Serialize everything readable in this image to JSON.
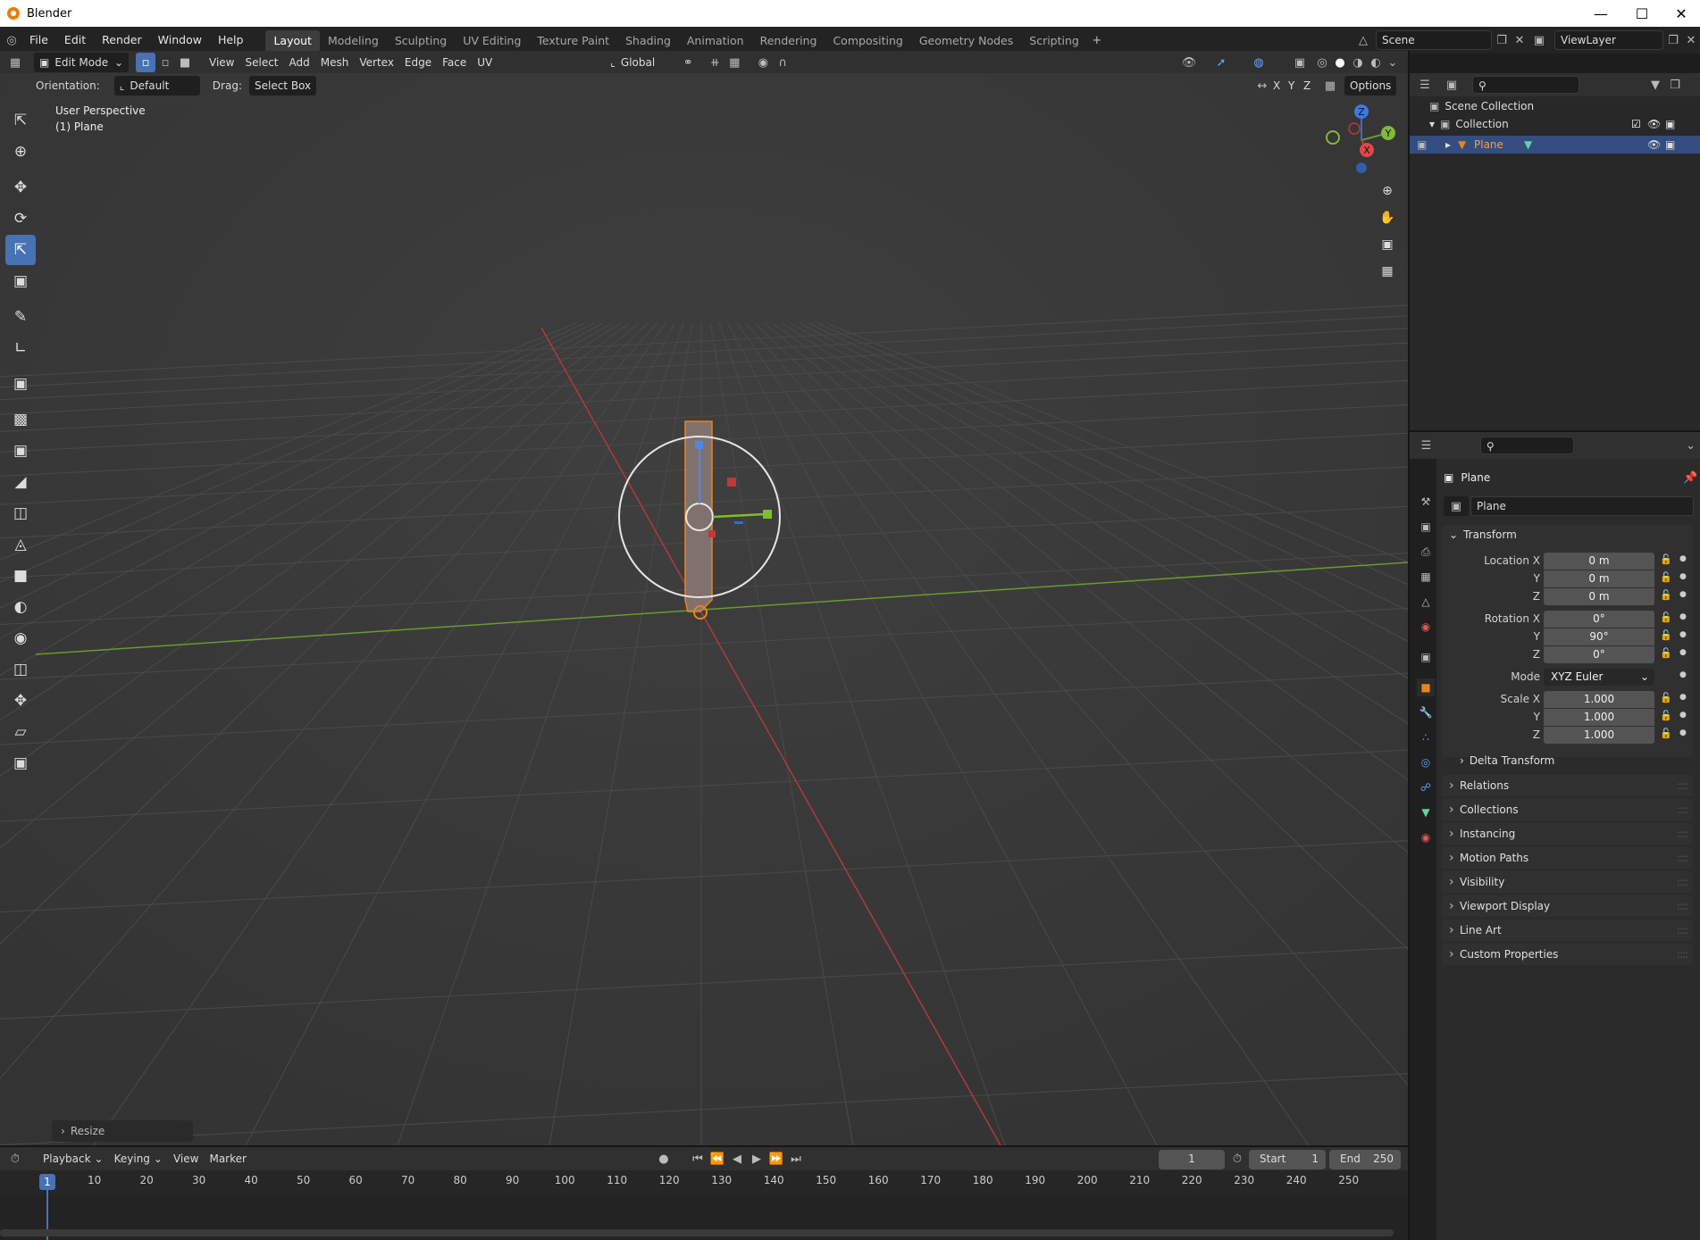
{
  "app": {
    "title": "Blender"
  },
  "menus": [
    "File",
    "Edit",
    "Render",
    "Window",
    "Help"
  ],
  "workspaces": [
    "Layout",
    "Modeling",
    "Sculpting",
    "UV Editing",
    "Texture Paint",
    "Shading",
    "Animation",
    "Rendering",
    "Compositing",
    "Geometry Nodes",
    "Scripting"
  ],
  "scene": {
    "name": "Scene",
    "view_layer": "ViewLayer"
  },
  "viewport_header": {
    "mode": "Edit Mode",
    "menus": [
      "View",
      "Select",
      "Add",
      "Mesh",
      "Vertex",
      "Edge",
      "Face",
      "UV"
    ],
    "transform_orientation": "Global",
    "orientation_label": "Orientation:",
    "orientation_value": "Default",
    "drag_label": "Drag:",
    "drag_value": "Select Box",
    "axes": [
      "X",
      "Y",
      "Z"
    ],
    "options": "Options"
  },
  "viewport": {
    "perspective": "User Perspective",
    "object": "(1) Plane",
    "last_operator": "Resize",
    "gizmo_axes": {
      "z": "Z",
      "y": "Y",
      "x": "X"
    }
  },
  "outliner": {
    "search_placeholder": "",
    "scene_collection": "Scene Collection",
    "collection": "Collection",
    "object": "Plane"
  },
  "properties": {
    "object_name": "Plane",
    "datablock": "Plane",
    "transform_label": "Transform",
    "location": {
      "label_x": "Location X",
      "label_y": "Y",
      "label_z": "Z",
      "x": "0 m",
      "y": "0 m",
      "z": "0 m"
    },
    "rotation": {
      "label_x": "Rotation X",
      "label_y": "Y",
      "label_z": "Z",
      "x": "0°",
      "y": "90°",
      "z": "0°"
    },
    "mode": {
      "label": "Mode",
      "value": "XYZ Euler"
    },
    "scale": {
      "label_x": "Scale X",
      "label_y": "Y",
      "label_z": "Z",
      "x": "1.000",
      "y": "1.000",
      "z": "1.000"
    },
    "delta_transform": "Delta Transform",
    "panels": [
      "Relations",
      "Collections",
      "Instancing",
      "Motion Paths",
      "Visibility",
      "Viewport Display",
      "Line Art",
      "Custom Properties"
    ]
  },
  "timeline": {
    "menus": [
      "Playback",
      "Keying",
      "View",
      "Marker"
    ],
    "current_frame": "1",
    "start_label": "Start",
    "start": "1",
    "end_label": "End",
    "end": "250",
    "ruler": [
      "1",
      "10",
      "20",
      "30",
      "40",
      "50",
      "60",
      "70",
      "80",
      "90",
      "100",
      "110",
      "120",
      "130",
      "140",
      "150",
      "160",
      "170",
      "180",
      "190",
      "200",
      "210",
      "220",
      "230",
      "240",
      "250"
    ]
  },
  "colors": {
    "accent": "#4772b3",
    "selection": "#e87d0d",
    "x_axis": "#c03838",
    "y_axis": "#6fa22a",
    "z_axis": "#2f6fd0"
  }
}
